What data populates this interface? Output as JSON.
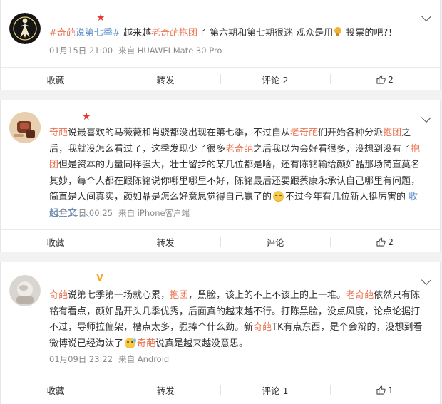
{
  "posts": [
    {
      "avatar": "sailor-moon-silhouette-avatar",
      "badge": "red-star",
      "segments": [
        {
          "t": "#奇葩",
          "c": "hl"
        },
        {
          "t": "说第七季#",
          "c": "ht"
        },
        {
          "t": " 越来越",
          "c": ""
        },
        {
          "t": "老奇葩",
          "c": "hl"
        },
        {
          "t": "抱团",
          "c": "hl"
        },
        {
          "t": "了 第六期和第七期很迷 观众是用",
          "c": ""
        },
        {
          "t": "[bulb]",
          "c": "icon"
        },
        {
          "t": " 投票的吧?！",
          "c": ""
        }
      ],
      "time": "01月15日 21:00",
      "source": "来自 HUAWEI Mate 30 Pro",
      "actions": {
        "fav": "收藏",
        "repost": "转发",
        "comment": "评论 2",
        "like": "2"
      }
    },
    {
      "avatar": "brown-photo-avatar",
      "badge": "red-star",
      "segments": [
        {
          "t": "奇葩",
          "c": "hl"
        },
        {
          "t": "说最喜欢的马薇薇和肖骁都没出现在第七季，不过自从",
          "c": ""
        },
        {
          "t": "老奇葩",
          "c": "hl"
        },
        {
          "t": "们开始各种分派",
          "c": ""
        },
        {
          "t": "抱团",
          "c": "hl"
        },
        {
          "t": "之后，我就没怎么看过了，这季发现少了很多",
          "c": ""
        },
        {
          "t": "老奇葩",
          "c": "hl"
        },
        {
          "t": "之后我以为会好看很多，没想到没有了",
          "c": ""
        },
        {
          "t": "抱团",
          "c": "hl"
        },
        {
          "t": "但是资本的力量同样强大，壮士留步的某几位都是啥，还有陈铭输给颜如晶那场简直莫名其妙，每个人都在跟陈铭说你哪里哪里不好，陈铭最后还要跟蔡康永承认自己哪里有问题，简直是人间真实，颜如晶是怎么好意思觉得自己赢了的",
          "c": ""
        },
        {
          "t": "[emoji]",
          "c": "icon"
        },
        {
          "t": "不过今年有几位新人挺厉害的 ",
          "c": ""
        },
        {
          "t": "收起全文",
          "c": "lk"
        }
      ],
      "time": "01月11日 00:25",
      "source": "来自 iPhone客户端",
      "actions": {
        "fav": "收藏",
        "repost": "转发",
        "comment": "评论",
        "like": "2"
      }
    },
    {
      "avatar": "pale-photo-avatar",
      "badge": "yellow-v",
      "segments": [
        {
          "t": "奇葩",
          "c": "hl"
        },
        {
          "t": "说第七季第一场就心累，",
          "c": ""
        },
        {
          "t": "抱团",
          "c": "hl"
        },
        {
          "t": "，黑脸，该上的不上不该上的上一堆。",
          "c": ""
        },
        {
          "t": "老奇葩",
          "c": "hl"
        },
        {
          "t": "依然只有陈铭有看点，颜如晶开头几季优秀，后面真的越来越不行。打陈黑脸，没点风度，论点论据打不过，导师拉偏架，槽点太多，强捧个什么劲。新",
          "c": ""
        },
        {
          "t": "奇葩",
          "c": "hl"
        },
        {
          "t": "TK有点东西，是个会辩的，没想到看微博说已经淘汰了",
          "c": ""
        },
        {
          "t": "[sweat]",
          "c": "icon"
        },
        {
          "t": "奇葩",
          "c": "hl"
        },
        {
          "t": "说真是越来越没意思。",
          "c": ""
        }
      ],
      "time": "01月09日 23:22",
      "source": "来自 Android",
      "actions": {
        "fav": "收藏",
        "repost": "转发",
        "comment": "评论 1",
        "like": "1"
      }
    }
  ],
  "colors": {
    "keyword": "#eb7350",
    "topic": "#5d8fc9",
    "star": "#e8372f",
    "vbadge": "#f5a623"
  }
}
